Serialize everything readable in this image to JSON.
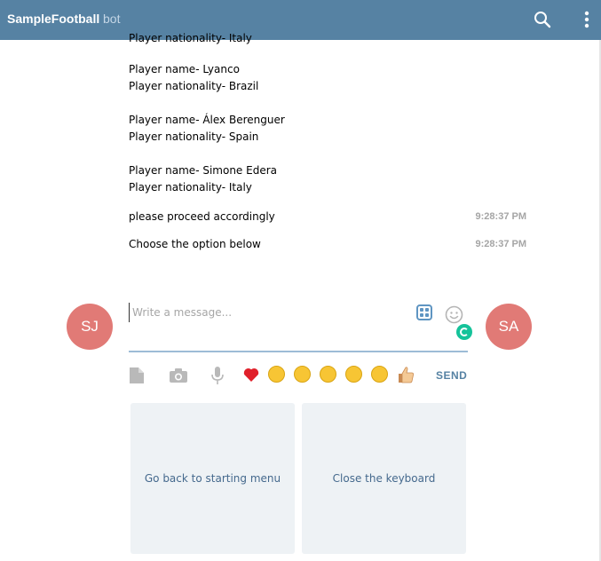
{
  "header": {
    "title": "SampleFootball",
    "tag": "bot"
  },
  "messages": {
    "clipped_line": "Player nationality- Italy",
    "players": [
      {
        "name": "Player name- Lyanco",
        "nationality": "Player nationality- Brazil"
      },
      {
        "name": "Player name- Álex Berenguer",
        "nationality": "Player nationality- Spain"
      },
      {
        "name": "Player name- Simone Edera",
        "nationality": "Player nationality- Italy"
      }
    ],
    "proceed": {
      "text": "please proceed accordingly",
      "time": "9:28:37 PM"
    },
    "choose": {
      "text": "Choose the option below",
      "time": "9:28:37 PM"
    }
  },
  "avatars": {
    "left": "SJ",
    "right": "SA"
  },
  "composer": {
    "placeholder": "Write a message..."
  },
  "toolbar": {
    "send_label": "SEND",
    "emojis": [
      "heart",
      "grinning-face",
      "crying-laughing-face",
      "heart-eyes-face",
      "smiling-face",
      "grimacing-face",
      "thumbs-up"
    ]
  },
  "keyboard": {
    "buttons": [
      "Go back to starting menu",
      "Close the keyboard"
    ]
  },
  "colors": {
    "header": "#5682a3",
    "avatar": "#e17a76",
    "send": "#5682a3",
    "keyboard_button_bg": "#eef2f5"
  }
}
